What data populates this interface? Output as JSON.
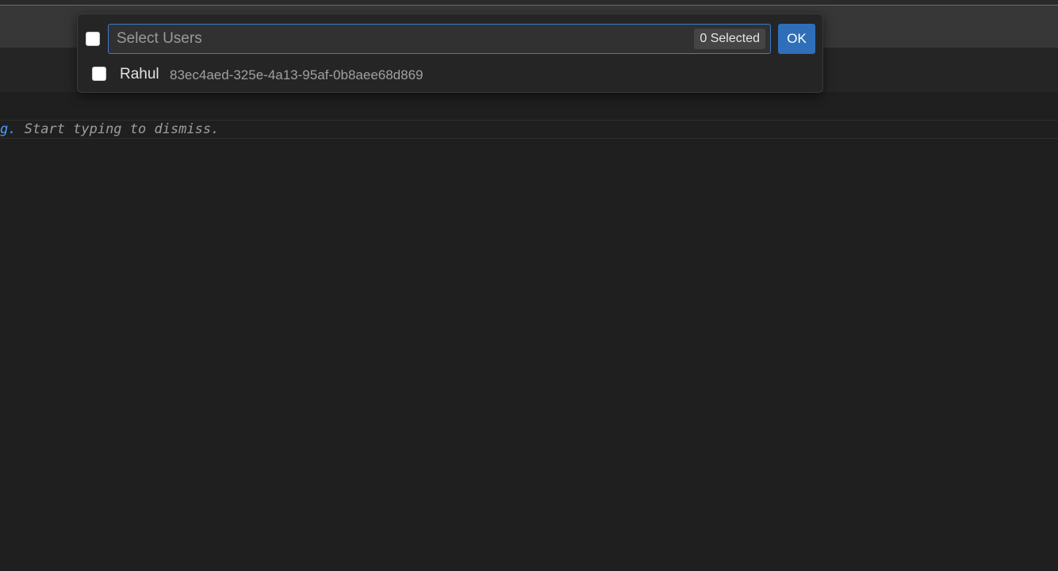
{
  "editor": {
    "hint_link": "g.",
    "hint_rest": " Start typing to dismiss."
  },
  "quick_pick": {
    "placeholder": "Select Users",
    "selected_count": "0 Selected",
    "ok_label": "OK",
    "items": [
      {
        "label": "Rahul",
        "description": "83ec4aed-325e-4a13-95af-0b8aee68d869",
        "checked": false
      }
    ]
  },
  "colors": {
    "accent": "#2f6fba",
    "focus_border": "#3b7cc9",
    "link": "#4b9bff",
    "background": "#1f1f1f"
  }
}
